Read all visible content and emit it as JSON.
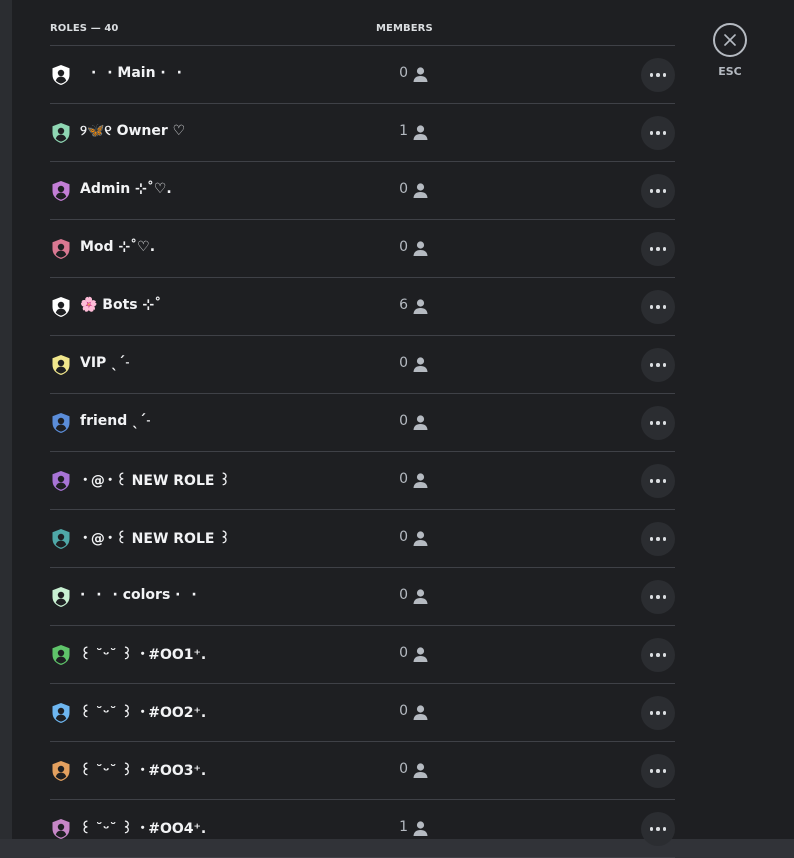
{
  "header": {
    "roles_label": "ROLES — 40",
    "members_label": "MEMBERS"
  },
  "close": {
    "esc_label": "ESC",
    "icon": "close-icon"
  },
  "roles": [
    {
      "name": "⠀·⠀· Main ·⠀·",
      "members": "0",
      "color": "#ffffff"
    },
    {
      "name": "୨🦋୧ Owner ♡",
      "members": "1",
      "color": "#8fd6b3"
    },
    {
      "name": "Admin ⊹˚♡.",
      "members": "0",
      "color": "#c37ed6"
    },
    {
      "name": "Mod ⊹˚♡.",
      "members": "0",
      "color": "#d97892"
    },
    {
      "name": "🌸 Bots ⊹˚",
      "members": "6",
      "color": "#ffffff"
    },
    {
      "name": "VIP ˎˊ˗",
      "members": "0",
      "color": "#f0e68c"
    },
    {
      "name": "friend ˎˊ˗",
      "members": "0",
      "color": "#5b8dd9"
    },
    {
      "name": "・@・꒰ NEW ROLE ꒱",
      "members": "0",
      "color": "#a874d6"
    },
    {
      "name": "・@・꒰ NEW ROLE ꒱",
      "members": "0",
      "color": "#4fa8a8"
    },
    {
      "name": "·⠀·⠀· colors ·⠀·",
      "members": "0",
      "color": "#c8f0d2"
    },
    {
      "name": "꒰ ˘ᵕ˘ ꒱ ・#OO1⁺.",
      "members": "0",
      "color": "#5fc46a"
    },
    {
      "name": "꒰ ˘ᵕ˘ ꒱ ・#OO2⁺.",
      "members": "0",
      "color": "#6eb6f0"
    },
    {
      "name": "꒰ ˘ᵕ˘ ꒱ ・#OO3⁺.",
      "members": "0",
      "color": "#e3a05f"
    },
    {
      "name": "꒰ ˘ᵕ˘ ꒱ ・#OO4⁺.",
      "members": "1",
      "color": "#c787c7"
    }
  ]
}
